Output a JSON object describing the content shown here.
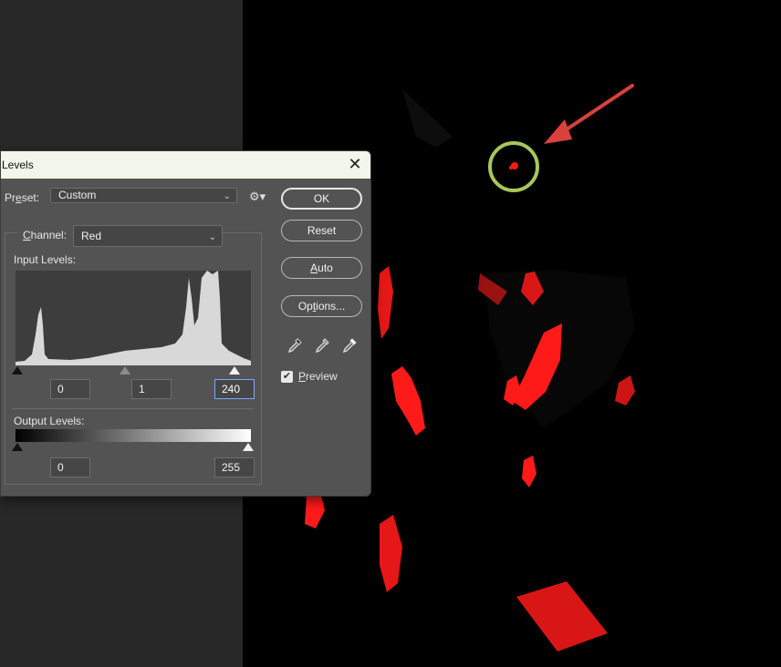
{
  "dialog": {
    "title": "Levels",
    "preset_label_parts": [
      "Pr",
      "e",
      "set:"
    ],
    "preset_value": "Custom",
    "channel_label_parts": [
      "",
      "C",
      "hannel:"
    ],
    "channel_value": "Red",
    "input_levels_label": "Input Levels:",
    "input_values": {
      "black": "0",
      "gamma": "1",
      "white": "240"
    },
    "output_levels_label": "Output Levels:",
    "output_values": {
      "black": "0",
      "white": "255"
    },
    "buttons": {
      "ok": "OK",
      "reset": "Reset",
      "auto_parts": [
        "",
        "A",
        "uto"
      ],
      "options_parts": [
        "Op",
        "t",
        "ions..."
      ]
    },
    "preview_label_parts": [
      "",
      "P",
      "review"
    ],
    "preview_checked": true
  },
  "icons": {
    "close": "close-icon",
    "gear": "gear-icon",
    "eyedroppers": [
      "black-point-eyedropper-icon",
      "gray-point-eyedropper-icon",
      "white-point-eyedropper-icon"
    ]
  },
  "colors": {
    "dialog_bg": "#535353",
    "canvas_bg": "#000000",
    "highlight_red": "#ff1a1a",
    "annotation_circle": "#a7c75a",
    "annotation_arrow": "#d9413d"
  }
}
